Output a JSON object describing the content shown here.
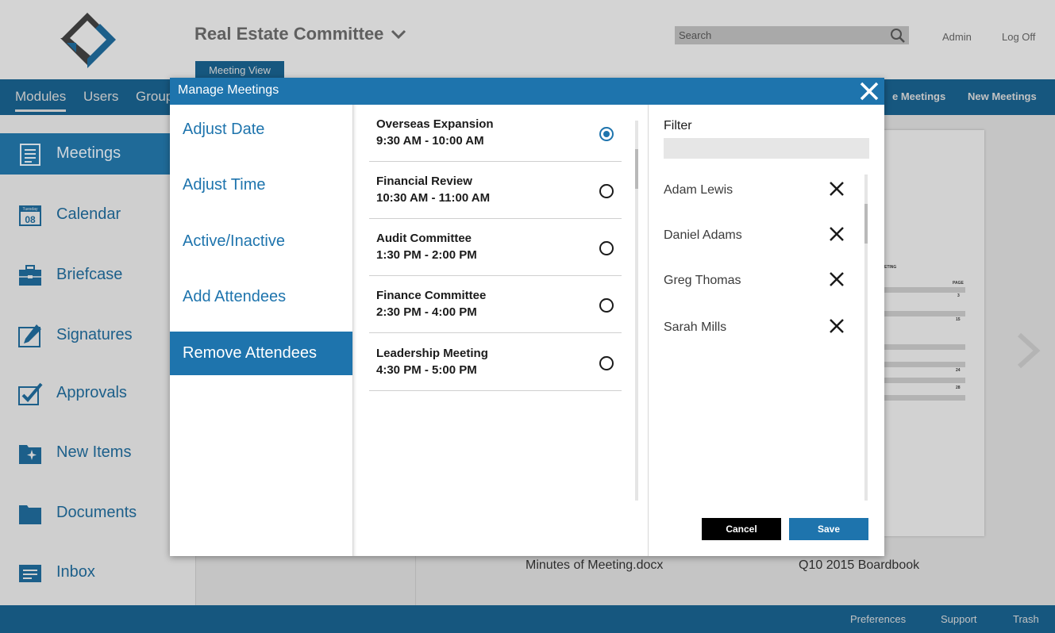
{
  "colors": {
    "brand_blue": "#1e74ad",
    "nav_blue": "#16577f",
    "overlay_gray": "#c9c9c9"
  },
  "header": {
    "committee_title": "Real Estate Committee",
    "search_placeholder": "Search",
    "admin_label": "Admin",
    "logoff_label": "Log Off",
    "meeting_view_tab": "Meeting View"
  },
  "navbar": {
    "items": [
      "Modules",
      "Users",
      "Group"
    ],
    "right": [
      "e Meetings",
      "New Meetings"
    ]
  },
  "sidebar": {
    "items": [
      {
        "label": "Meetings",
        "icon": "meetings-icon",
        "active": true
      },
      {
        "label": "Calendar",
        "icon": "calendar-icon",
        "day_label": "Tuesday",
        "day_number": "08"
      },
      {
        "label": "Briefcase",
        "icon": "briefcase-icon"
      },
      {
        "label": "Signatures",
        "icon": "signature-icon"
      },
      {
        "label": "Approvals",
        "icon": "approval-check-icon"
      },
      {
        "label": "New Items",
        "icon": "new-items-icon"
      },
      {
        "label": "Documents",
        "icon": "folder-icon"
      },
      {
        "label": "Inbox",
        "icon": "inbox-icon"
      }
    ]
  },
  "content": {
    "doc_captions": [
      "Minutes of Meeting.docx",
      "Q10 2015 Boardbook"
    ],
    "doc_page_text": {
      "heading": "ETING",
      "col": "PAGE",
      "nums": [
        "3",
        "15",
        "24",
        "28"
      ]
    }
  },
  "footer": {
    "links": [
      "Preferences",
      "Support",
      "Trash"
    ]
  },
  "modal": {
    "title": "Manage Meetings",
    "menu": [
      {
        "label": "Adjust Date",
        "active": false
      },
      {
        "label": "Adjust Time",
        "active": false
      },
      {
        "label": "Active/Inactive",
        "active": false
      },
      {
        "label": "Add Attendees",
        "active": false
      },
      {
        "label": "Remove Attendees",
        "active": true
      }
    ],
    "meetings": [
      {
        "name": "Overseas Expansion",
        "time": "9:30 AM - 10:00 AM",
        "selected": true
      },
      {
        "name": "Financial Review",
        "time": "10:30 AM - 11:00 AM",
        "selected": false
      },
      {
        "name": "Audit Committee",
        "time": "1:30 PM - 2:00 PM",
        "selected": false
      },
      {
        "name": "Finance Committee",
        "time": "2:30 PM - 4:00 PM",
        "selected": false
      },
      {
        "name": "Leadership Meeting",
        "time": "4:30 PM - 5:00 PM",
        "selected": false
      }
    ],
    "filter_label": "Filter",
    "filter_value": "",
    "attendees": [
      "Adam Lewis",
      "Daniel Adams",
      "Greg Thomas",
      "Sarah Mills"
    ],
    "cancel_label": "Cancel",
    "save_label": "Save"
  }
}
